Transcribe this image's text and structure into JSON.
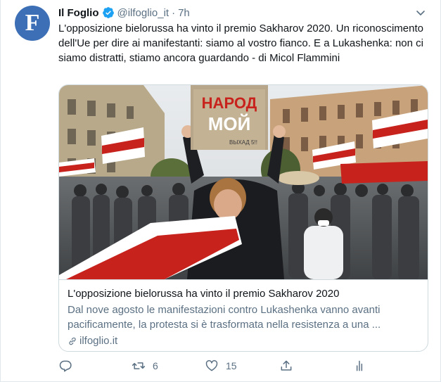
{
  "tweet": {
    "avatar_letter": "F",
    "author_name": "Il Foglio",
    "handle": "@ilfoglio_it",
    "separator": "·",
    "time": "7h",
    "text": "L'opposizione bielorussa ha vinto il premio Sakharov 2020. Un riconoscimento dell'Ue per dire ai manifestanti: siamo al vostro fianco. E a Lukashenka: non ci siamo distratti, stiamo ancora guardando - di Micol Flammini"
  },
  "card": {
    "photo_sign_text_1": "НАРОД",
    "photo_sign_text_2": "МОЙ",
    "photo_sign_small": "ВЫХАД 5!!",
    "title": "L'opposizione bielorussa ha vinto il premio Sakharov 2020",
    "description": "Dal nove agosto le manifestazioni contro Lukashenka vanno avanti pacificamente, la protesta si è trasformata nella resistenza a una ...",
    "domain": "ilfoglio.it"
  },
  "actions": {
    "reply_count": "",
    "retweet_count": "6",
    "like_count": "15"
  },
  "colors": {
    "accent": "#1da1f2",
    "avatar_bg": "#3c6fb5",
    "flag_red": "#c8221d",
    "muted": "#5b7083"
  }
}
